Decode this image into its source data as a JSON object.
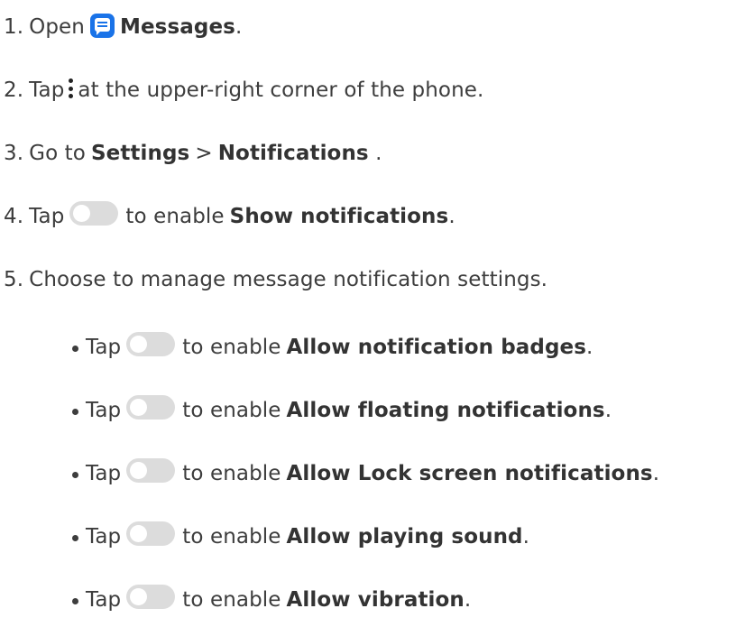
{
  "steps": [
    {
      "num": "1.",
      "pre": "Open",
      "bold": "Messages",
      "post": ".",
      "icon": "messages-app-icon",
      "icon_color": "#1a73e8"
    },
    {
      "num": "2.",
      "pre": "Tap",
      "post": "at the upper-right corner of the phone.",
      "icon": "more-vertical-icon"
    },
    {
      "num": "3.",
      "pre": "Go to",
      "bold1": "Settings",
      "sep": ">",
      "bold2": "Notifications",
      "post": " ."
    },
    {
      "num": "4.",
      "pre": "Tap",
      "mid": "to enable",
      "bold": "Show notifications",
      "post": ".",
      "icon": "toggle-switch-icon"
    },
    {
      "num": "5.",
      "text": "Choose to manage message notification settings."
    }
  ],
  "substeps": [
    {
      "pre": "Tap",
      "mid": "to enable",
      "bold": "Allow notification badges",
      "post": "."
    },
    {
      "pre": "Tap",
      "mid": "to enable",
      "bold": "Allow floating notifications",
      "post": "."
    },
    {
      "pre": "Tap",
      "mid": "to enable",
      "bold": "Allow Lock screen notifications",
      "post": "."
    },
    {
      "pre": "Tap",
      "mid": "to enable",
      "bold": "Allow playing sound",
      "post": "."
    },
    {
      "pre": "Tap",
      "mid": "to enable",
      "bold": "Allow vibration",
      "post": "."
    }
  ],
  "toggle_color": "#dcdcdc"
}
